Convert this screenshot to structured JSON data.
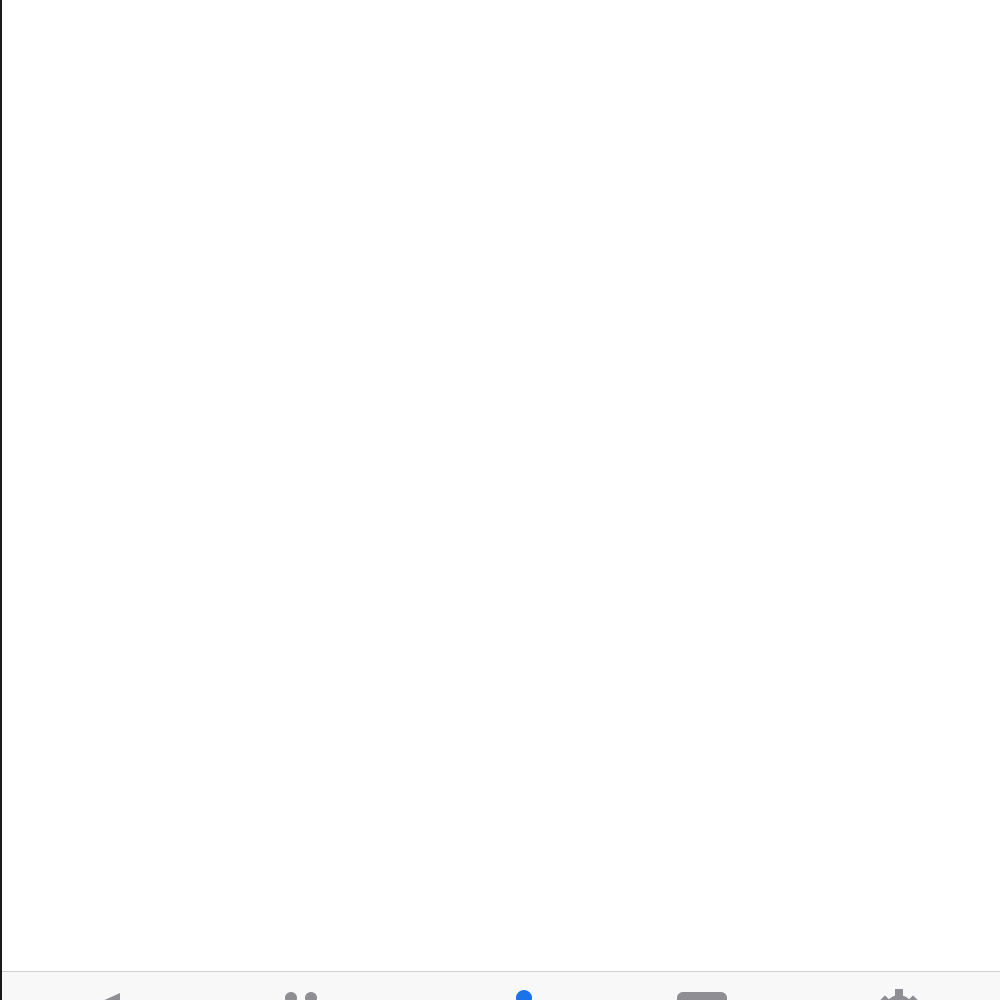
{
  "colors": {
    "tab_inactive": "#8e8e93",
    "tab_active": "#1a73e8",
    "tab_bar_background": "#f8f8f8",
    "tab_bar_border": "#cfcfcf",
    "content_background": "#ffffff"
  },
  "tab_bar": {
    "tabs": [
      {
        "icon": "megaphone-icon",
        "active": false
      },
      {
        "icon": "people-icon",
        "active": false
      },
      {
        "icon": "person-icon",
        "active": true
      },
      {
        "icon": "inbox-icon",
        "active": false
      },
      {
        "icon": "settings-gear-icon",
        "active": false
      }
    ]
  }
}
